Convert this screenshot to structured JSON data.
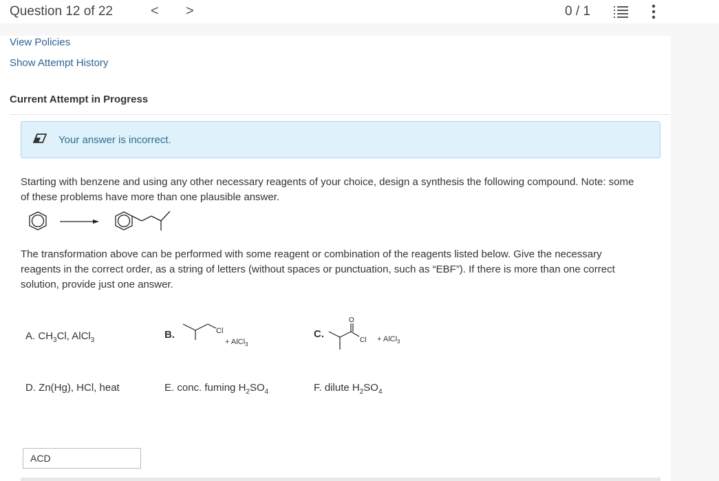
{
  "header": {
    "question_label": "Question 12 of 22",
    "prev_glyph": "<",
    "next_glyph": ">",
    "score": "0 / 1",
    "list_icon": "list-numbered-icon",
    "more_icon": "more-vertical-icon"
  },
  "links": {
    "view_policies": "View Policies",
    "show_history": "Show Attempt History"
  },
  "attempt_heading": "Current Attempt in Progress",
  "feedback": {
    "icon": "eraser-icon",
    "text": "Your answer is incorrect.",
    "background": "#dff1fa"
  },
  "question": {
    "line1": "Starting with benzene and using any other necessary reagents of your choice, design a synthesis the following compound. Note: some",
    "line2": "of these problems have more than one plausible answer.",
    "instr1": "The transformation above can be performed with some reagent or combination of the reagents listed below. Give the necessary",
    "instr2": "reagents in the correct order, as a string of letters (without spaces or punctuation, such as “EBF”). If there is more than one correct",
    "instr3": "solution, provide just one answer."
  },
  "options": {
    "A": {
      "letter": "A.",
      "text_pre": "CH",
      "sub1": "3",
      "text_mid": "Cl, AlCl",
      "sub2": "3"
    },
    "B": {
      "letter": "B.",
      "cl": "Cl",
      "reagent": "+ AlCl",
      "sub": "3"
    },
    "C": {
      "letter": "C.",
      "o": "O",
      "cl": "Cl",
      "reagent": "+ AlCl",
      "sub": "3"
    },
    "D": {
      "letter": "D.",
      "text": "Zn(Hg), HCl, heat"
    },
    "E": {
      "letter": "E.",
      "text": "conc. fuming H",
      "sub1": "2",
      "mid": "SO",
      "sub2": "4"
    },
    "F": {
      "letter": "F.",
      "text": "dilute H",
      "sub1": "2",
      "mid": "SO",
      "sub2": "4"
    }
  },
  "answer": {
    "value": "ACD"
  }
}
